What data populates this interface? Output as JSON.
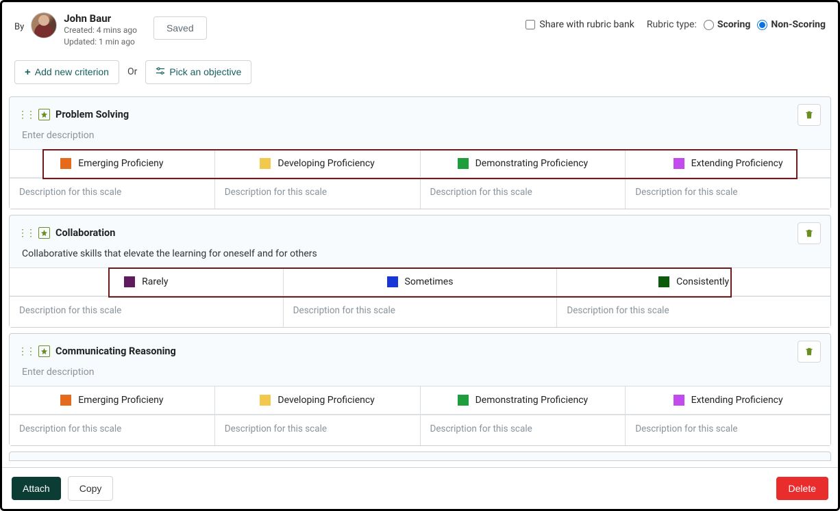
{
  "header": {
    "by_label": "By",
    "author_name": "John Baur",
    "created_line": "Created: 4 mins ago",
    "updated_line": "Updated: 1 min ago",
    "saved_button": "Saved",
    "share_label": "Share with rubric bank",
    "rubric_type_label": "Rubric type:",
    "scoring_label": "Scoring",
    "non_scoring_label": "Non-Scoring"
  },
  "toolbar": {
    "add_criterion": "Add new criterion",
    "or_label": "Or",
    "pick_objective": "Pick an objective"
  },
  "placeholders": {
    "enter_description": "Enter description",
    "scale_description": "Description for this scale"
  },
  "colors": {
    "emerging": "#e56a1c",
    "developing": "#f2c94c",
    "demonstrating": "#1e9e3c",
    "extending": "#c24bf0",
    "rarely": "#5e1c5e",
    "sometimes": "#1636d6",
    "consistently": "#0c5a0c"
  },
  "criteria": [
    {
      "title": "Problem Solving",
      "description": "",
      "highlight": true,
      "scales": [
        {
          "label": "Emerging Proficieny",
          "color_key": "emerging"
        },
        {
          "label": "Developing Proficiency",
          "color_key": "developing"
        },
        {
          "label": "Demonstrating Proficiency",
          "color_key": "demonstrating"
        },
        {
          "label": "Extending Proficiency",
          "color_key": "extending"
        }
      ]
    },
    {
      "title": "Collaboration",
      "description": "Collaborative skills that elevate the learning for oneself and for others",
      "highlight": true,
      "scales": [
        {
          "label": "Rarely",
          "color_key": "rarely"
        },
        {
          "label": "Sometimes",
          "color_key": "sometimes"
        },
        {
          "label": "Consistently",
          "color_key": "consistently"
        }
      ]
    },
    {
      "title": "Communicating Reasoning",
      "description": "",
      "highlight": false,
      "scales": [
        {
          "label": "Emerging Proficieny",
          "color_key": "emerging"
        },
        {
          "label": "Developing Proficiency",
          "color_key": "developing"
        },
        {
          "label": "Demonstrating Proficiency",
          "color_key": "demonstrating"
        },
        {
          "label": "Extending Proficiency",
          "color_key": "extending"
        }
      ]
    }
  ],
  "footer": {
    "attach": "Attach",
    "copy": "Copy",
    "delete": "Delete"
  }
}
